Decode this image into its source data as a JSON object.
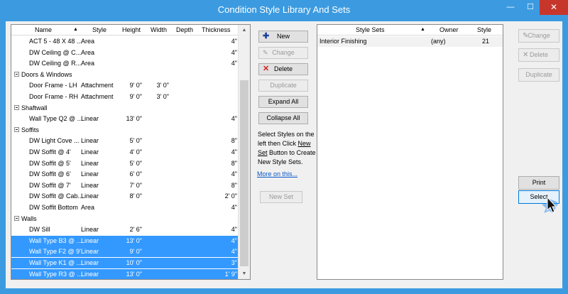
{
  "window": {
    "title": "Condition Style Library And Sets",
    "minimize_glyph": "—",
    "maximize_glyph": "☐",
    "close_glyph": "✕"
  },
  "left_list": {
    "columns": {
      "name": "Name",
      "sort_glyph": "▲",
      "style": "Style",
      "height": "Height",
      "width": "Width",
      "depth": "Depth",
      "thickness": "Thickness"
    },
    "rows": [
      {
        "kind": "item",
        "name": "ACT 5 - 48 X 48 ...",
        "style": "Area",
        "height": "",
        "width": "",
        "thickness": "4\"",
        "selected": false
      },
      {
        "kind": "item",
        "name": "DW Ceiling @ C...",
        "style": "Area",
        "height": "",
        "width": "",
        "thickness": "4\"",
        "selected": false
      },
      {
        "kind": "item",
        "name": "DW Ceiling @ R...",
        "style": "Area",
        "height": "",
        "width": "",
        "thickness": "4\"",
        "selected": false
      },
      {
        "kind": "group",
        "name": "Doors & Windows"
      },
      {
        "kind": "item",
        "name": "Door Frame - LH",
        "style": "Attachment",
        "height": "9' 0\"",
        "width": "3' 0\"",
        "thickness": "",
        "selected": false
      },
      {
        "kind": "item",
        "name": "Door Frame - RH",
        "style": "Attachment",
        "height": "9' 0\"",
        "width": "3' 0\"",
        "thickness": "",
        "selected": false
      },
      {
        "kind": "group",
        "name": "Shaftwall"
      },
      {
        "kind": "item",
        "name": "Wall Type Q2 @ ...",
        "style": "Linear",
        "height": "13' 0\"",
        "width": "",
        "thickness": "4\"",
        "selected": false
      },
      {
        "kind": "group",
        "name": "Soffits"
      },
      {
        "kind": "item",
        "name": "DW Light Cove ...",
        "style": "Linear",
        "height": "5' 0\"",
        "width": "",
        "thickness": "8\"",
        "selected": false
      },
      {
        "kind": "item",
        "name": "DW Soffit @ 4'",
        "style": "Linear",
        "height": "4' 0\"",
        "width": "",
        "thickness": "4\"",
        "selected": false
      },
      {
        "kind": "item",
        "name": "DW Soffit @ 5'",
        "style": "Linear",
        "height": "5' 0\"",
        "width": "",
        "thickness": "8\"",
        "selected": false
      },
      {
        "kind": "item",
        "name": "DW Soffit @ 6'",
        "style": "Linear",
        "height": "6' 0\"",
        "width": "",
        "thickness": "4\"",
        "selected": false
      },
      {
        "kind": "item",
        "name": "DW Soffit @ 7'",
        "style": "Linear",
        "height": "7' 0\"",
        "width": "",
        "thickness": "8\"",
        "selected": false
      },
      {
        "kind": "item",
        "name": "DW Soffit @ Cab...",
        "style": "Linear",
        "height": "8' 0\"",
        "width": "",
        "thickness": "2' 0\"",
        "selected": false
      },
      {
        "kind": "item",
        "name": "DW Soffit Bottom",
        "style": "Area",
        "height": "",
        "width": "",
        "thickness": "4\"",
        "selected": false
      },
      {
        "kind": "group",
        "name": "Walls"
      },
      {
        "kind": "item",
        "name": "DW Sill",
        "style": "Linear",
        "height": "2' 6\"",
        "width": "",
        "thickness": "4\"",
        "selected": false
      },
      {
        "kind": "item",
        "name": "Wall Type B3 @ ...",
        "style": "Linear",
        "height": "13' 0\"",
        "width": "",
        "thickness": "4\"",
        "selected": true
      },
      {
        "kind": "item",
        "name": "Wall Type F2 @ 9'",
        "style": "Linear",
        "height": "9' 0\"",
        "width": "",
        "thickness": "4\"",
        "selected": true
      },
      {
        "kind": "item",
        "name": "Wall Type K1 @ ...",
        "style": "Linear",
        "height": "10' 0\"",
        "width": "",
        "thickness": "3\"",
        "selected": true
      },
      {
        "kind": "item",
        "name": "Wall Type R3 @ ...",
        "style": "Linear",
        "height": "13' 0\"",
        "width": "",
        "thickness": "1' 9\"",
        "selected": true
      }
    ]
  },
  "middle": {
    "new_label": "New",
    "change_label": "Change",
    "delete_label": "Delete",
    "duplicate_label": "Duplicate",
    "expand_all_label": "Expand All",
    "collapse_all_label": "Collapse All",
    "help_text_before": "Select Styles on the left then Click ",
    "help_link_text": "New Set",
    "help_text_after": " Button to Create New Style Sets.",
    "more_link": "More on this...",
    "new_set_label": "New Set"
  },
  "right_list": {
    "columns": {
      "style_sets": "Style Sets",
      "sort_glyph": "▲",
      "owner": "Owner",
      "style": "Style"
    },
    "rows": [
      {
        "style_sets": "Interior Finishing",
        "owner": "(any)",
        "style": "21"
      }
    ]
  },
  "right_buttons": {
    "change_label": "Change",
    "delete_label": "Delete",
    "duplicate_label": "Duplicate",
    "print_label": "Print",
    "select_label": "Select"
  }
}
